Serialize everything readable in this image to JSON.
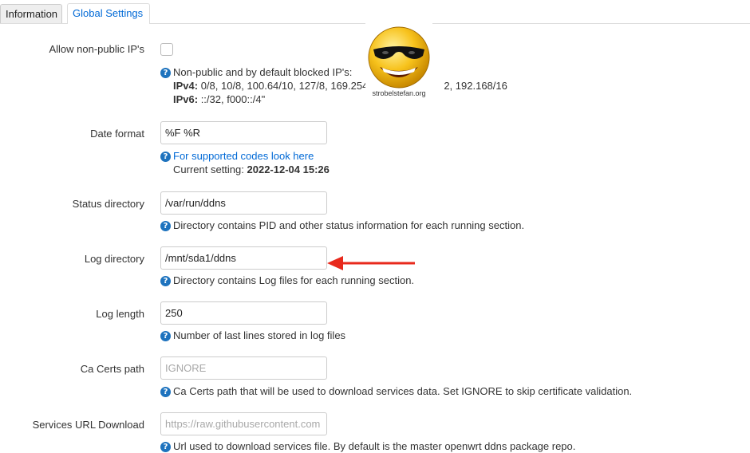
{
  "tabs": [
    {
      "label": "Information"
    },
    {
      "label": "Global Settings"
    }
  ],
  "non_public": {
    "label": "Allow non-public IP's",
    "checked": false,
    "help_line1": "Non-public and by default blocked IP's:",
    "ipv4_label": "IPv4:",
    "ipv4_value": " 0/8, 10/8, 100.64/10, 127/8, 169.254",
    "ipv4_tail": "2, 192.168/16",
    "ipv6_label": "IPv6:",
    "ipv6_value": " ::/32, f000::/4\""
  },
  "logo": {
    "caption": "strobelstefan.org"
  },
  "date_format": {
    "label": "Date format",
    "value": "%F %R",
    "help_link": "For supported codes look here",
    "current_label": "Current setting: ",
    "current_value": "2022-12-04 15:26"
  },
  "status_dir": {
    "label": "Status directory",
    "value": "/var/run/ddns",
    "help": "Directory contains PID and other status information for each running section."
  },
  "log_dir": {
    "label": "Log directory",
    "value": "/mnt/sda1/ddns",
    "help": "Directory contains Log files for each running section."
  },
  "log_length": {
    "label": "Log length",
    "value": "250",
    "help": "Number of last lines stored in log files"
  },
  "ca_certs": {
    "label": "Ca Certs path",
    "placeholder": "IGNORE",
    "help": "Ca Certs path that will be used to download services data. Set IGNORE to skip certificate validation."
  },
  "services_url": {
    "label": "Services URL Download",
    "placeholder": "https://raw.githubusercontent.com",
    "help": "Url used to download services file. By default is the master openwrt ddns package repo."
  },
  "colors": {
    "arrow": "#e8291c",
    "link": "#0069d6",
    "help_icon": "#1e73be"
  }
}
